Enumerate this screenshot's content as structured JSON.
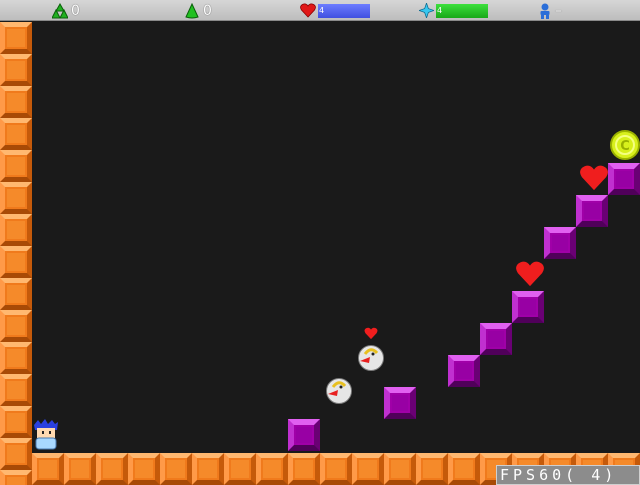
{
  "hud": {
    "gems_label": "0",
    "slimes_label": "0",
    "hearts_label": "4",
    "hearts_level": 1.0,
    "stars_label": "4",
    "stars_level": 1.0,
    "lives_label": "–",
    "colors": {
      "hearts_bar": "#6d7dff",
      "stars_bar": "#3ce03c"
    }
  },
  "fps_text": "FPS60( 4)",
  "icons": [
    "gem-cluster-icon",
    "slime-icon",
    "heart-icon",
    "star-icon",
    "player-icon",
    "coin-icon",
    "bird-enemy-icon"
  ],
  "coin_label": "C"
}
